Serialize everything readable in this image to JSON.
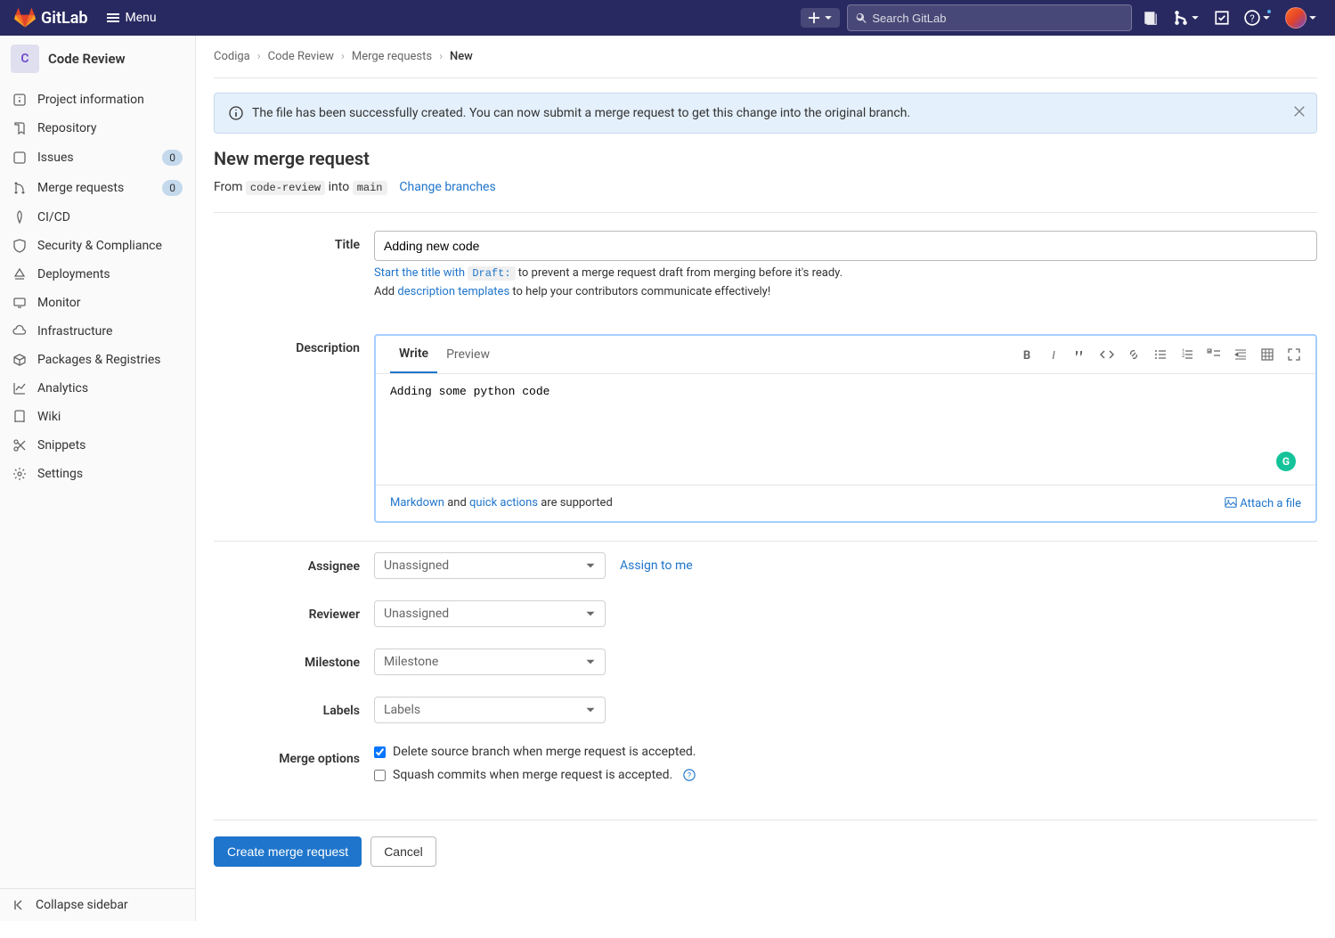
{
  "app": {
    "name": "GitLab",
    "menu": "Menu",
    "search_placeholder": "Search GitLab"
  },
  "breadcrumbs": {
    "a": "Codiga",
    "b": "Code Review",
    "c": "Merge requests",
    "d": "New"
  },
  "flash": "The file has been successfully created. You can now submit a merge request to get this change into the original branch.",
  "page_title": "New merge request",
  "branches": {
    "from_label": "From",
    "into_label": "into",
    "from": "code-review",
    "into": "main",
    "change": "Change branches"
  },
  "sidebar": {
    "project_initial": "C",
    "project_name": "Code Review",
    "items": [
      {
        "label": "Project information"
      },
      {
        "label": "Repository"
      },
      {
        "label": "Issues",
        "badge": "0"
      },
      {
        "label": "Merge requests",
        "badge": "0"
      },
      {
        "label": "CI/CD"
      },
      {
        "label": "Security & Compliance"
      },
      {
        "label": "Deployments"
      },
      {
        "label": "Monitor"
      },
      {
        "label": "Infrastructure"
      },
      {
        "label": "Packages & Registries"
      },
      {
        "label": "Analytics"
      },
      {
        "label": "Wiki"
      },
      {
        "label": "Snippets"
      },
      {
        "label": "Settings"
      }
    ],
    "collapse": "Collapse sidebar"
  },
  "form": {
    "title": {
      "label": "Title",
      "value": "Adding new code",
      "hint1_link": "Start the title with",
      "hint1_code": "Draft:",
      "hint1_rest": "to prevent a merge request draft from merging before it's ready.",
      "hint2_prefix": "Add",
      "hint2_link": "description templates",
      "hint2_rest": "to help your contributors communicate effectively!"
    },
    "description": {
      "label": "Description",
      "tabs": {
        "write": "Write",
        "preview": "Preview"
      },
      "value": "Adding some python code",
      "footer_md": "Markdown",
      "footer_and": "and",
      "footer_qa": "quick actions",
      "footer_supported": "are supported",
      "attach": "Attach a file"
    },
    "assignee": {
      "label": "Assignee",
      "placeholder": "Unassigned",
      "assign_me": "Assign to me"
    },
    "reviewer": {
      "label": "Reviewer",
      "placeholder": "Unassigned"
    },
    "milestone": {
      "label": "Milestone",
      "placeholder": "Milestone"
    },
    "labels": {
      "label": "Labels",
      "placeholder": "Labels"
    },
    "merge_options": {
      "label": "Merge options",
      "delete": "Delete source branch when merge request is accepted.",
      "squash": "Squash commits when merge request is accepted."
    }
  },
  "actions": {
    "create": "Create merge request",
    "cancel": "Cancel"
  }
}
